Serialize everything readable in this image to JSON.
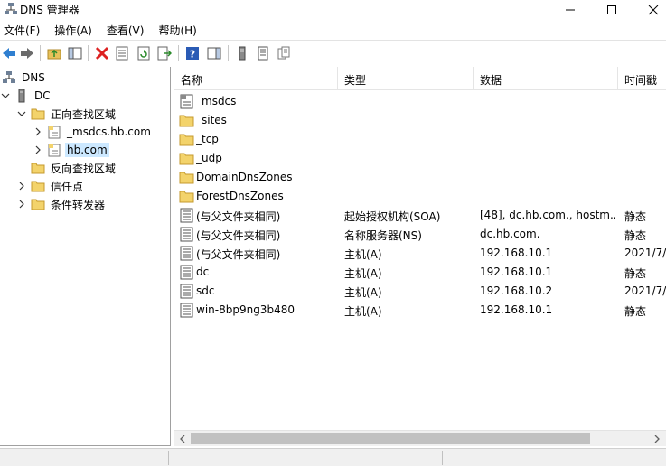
{
  "window": {
    "title": "DNS 管理器"
  },
  "menu": [
    "文件(F)",
    "操作(A)",
    "查看(V)",
    "帮助(H)"
  ],
  "toolbar": {
    "buttons": [
      "back-arrow-icon",
      "forward-arrow-icon",
      "up-folder-icon",
      "show-hide-tree-icon",
      "delete-icon",
      "properties-icon",
      "refresh-icon",
      "export-list-icon",
      "help-icon",
      "action-pane-icon",
      "server-icon",
      "zone-list-icon",
      "records-icon"
    ]
  },
  "tree": [
    {
      "label": "DNS",
      "icon": "dns-root-icon",
      "expander": "",
      "level": 0
    },
    {
      "label": "DC",
      "icon": "server-icon",
      "expander": "down",
      "level": 0
    },
    {
      "label": "正向查找区域",
      "icon": "folder-icon",
      "expander": "down",
      "level": 1
    },
    {
      "label": "_msdcs.hb.com",
      "icon": "zone-icon",
      "expander": "right",
      "level": 2
    },
    {
      "label": "hb.com",
      "icon": "zone-icon",
      "expander": "right",
      "level": 2,
      "selected": true
    },
    {
      "label": "反向查找区域",
      "icon": "folder-icon",
      "expander": "",
      "level": 1
    },
    {
      "label": "信任点",
      "icon": "folder-icon",
      "expander": "right",
      "level": 1
    },
    {
      "label": "条件转发器",
      "icon": "folder-icon",
      "expander": "right",
      "level": 1
    }
  ],
  "columns": [
    "名称",
    "类型",
    "数据",
    "时间戳"
  ],
  "rows": [
    {
      "name": "_msdcs",
      "type": "",
      "data": "",
      "timestamp": "",
      "icon": "delegated-zone-icon"
    },
    {
      "name": "_sites",
      "type": "",
      "data": "",
      "timestamp": "",
      "icon": "folder-icon"
    },
    {
      "name": "_tcp",
      "type": "",
      "data": "",
      "timestamp": "",
      "icon": "folder-icon"
    },
    {
      "name": "_udp",
      "type": "",
      "data": "",
      "timestamp": "",
      "icon": "folder-icon"
    },
    {
      "name": "DomainDnsZones",
      "type": "",
      "data": "",
      "timestamp": "",
      "icon": "folder-icon"
    },
    {
      "name": "ForestDnsZones",
      "type": "",
      "data": "",
      "timestamp": "",
      "icon": "folder-icon"
    },
    {
      "name": "(与父文件夹相同)",
      "type": "起始授权机构(SOA)",
      "data": "[48], dc.hb.com., hostm...",
      "timestamp": "静态",
      "icon": "record-icon"
    },
    {
      "name": "(与父文件夹相同)",
      "type": "名称服务器(NS)",
      "data": "dc.hb.com.",
      "timestamp": "静态",
      "icon": "record-icon"
    },
    {
      "name": "(与父文件夹相同)",
      "type": "主机(A)",
      "data": "192.168.10.1",
      "timestamp": "2021/7/",
      "icon": "record-icon"
    },
    {
      "name": "dc",
      "type": "主机(A)",
      "data": "192.168.10.1",
      "timestamp": "静态",
      "icon": "record-icon"
    },
    {
      "name": "sdc",
      "type": "主机(A)",
      "data": "192.168.10.2",
      "timestamp": "2021/7/",
      "icon": "record-icon"
    },
    {
      "name": "win-8bp9ng3b480",
      "type": "主机(A)",
      "data": "192.168.10.1",
      "timestamp": "静态",
      "icon": "record-icon"
    }
  ]
}
